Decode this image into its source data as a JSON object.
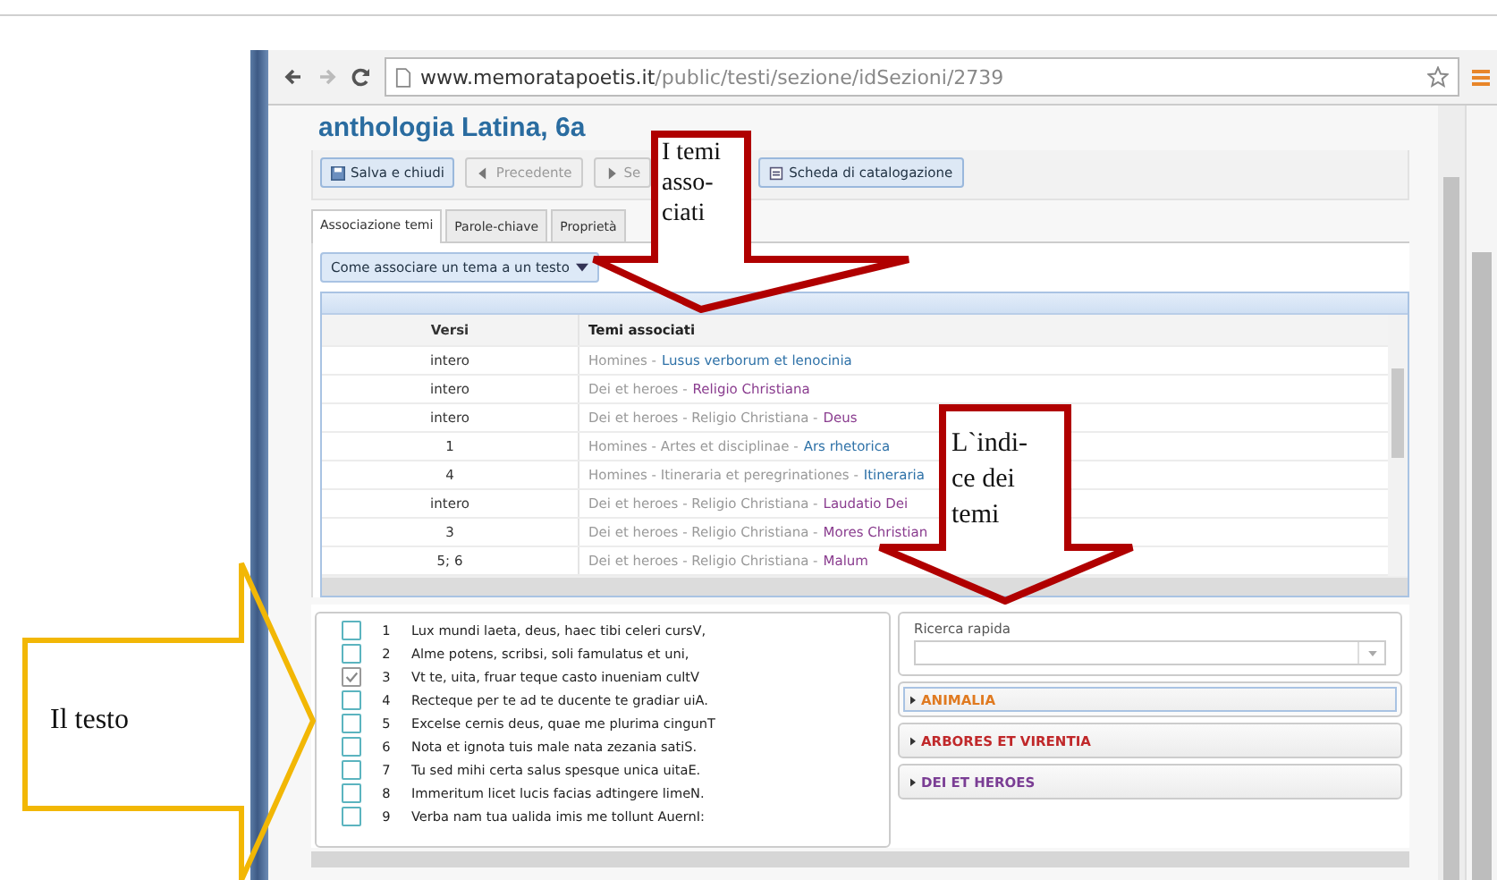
{
  "browser": {
    "url_host": "www.memoratapoetis.it",
    "url_path": "/public/testi/sezione/idSezioni/2739"
  },
  "page": {
    "title": "anthologia Latina, 6a"
  },
  "toolbar": [
    {
      "label": "Salva e chiudi",
      "kind": "save",
      "disabled": false
    },
    {
      "label": "Precedente",
      "kind": "prev",
      "disabled": true
    },
    {
      "label": "Se",
      "kind": "next",
      "disabled": true
    },
    {
      "label": "Scheda di catalogazione",
      "kind": "sheet",
      "disabled": false
    }
  ],
  "tabs": [
    {
      "label": "Associazione temi",
      "selected": true
    },
    {
      "label": "Parole-chiave",
      "selected": false
    },
    {
      "label": "Proprietà",
      "selected": false
    }
  ],
  "help_menu": {
    "label": "Come associare un tema a un testo"
  },
  "table": {
    "columns": [
      "Versi",
      "Temi associati"
    ],
    "rows": [
      {
        "verses": "intero",
        "path": "Homines -",
        "leaf": "Lusus verborum et lenocinia",
        "color": "#2f72a8"
      },
      {
        "verses": "intero",
        "path": "Dei et heroes -",
        "leaf": "Religio Christiana",
        "color": "#8a3d8f"
      },
      {
        "verses": "intero",
        "path": "Dei et heroes - Religio Christiana -",
        "leaf": "Deus",
        "color": "#8a3d8f"
      },
      {
        "verses": "1",
        "path": "Homines - Artes et disciplinae -",
        "leaf": "Ars rhetorica",
        "color": "#2f72a8"
      },
      {
        "verses": "4",
        "path": "Homines - Itineraria et peregrinationes -",
        "leaf": "Itineraria",
        "color": "#2f72a8"
      },
      {
        "verses": "intero",
        "path": "Dei et heroes - Religio Christiana -",
        "leaf": "Laudatio Dei",
        "color": "#8a3d8f"
      },
      {
        "verses": "3",
        "path": "Dei et heroes - Religio Christiana -",
        "leaf": "Mores Christian",
        "color": "#8a3d8f"
      },
      {
        "verses": "5; 6",
        "path": "Dei et heroes - Religio Christiana -",
        "leaf": "Malum",
        "color": "#8a3d8f"
      }
    ]
  },
  "verses": [
    {
      "number": "1",
      "text": "Lux mundi laeta, deus, haec tibi celeri cursV,",
      "checked": false
    },
    {
      "number": "2",
      "text": "Alme potens, scribsi, soli famulatus et uni,",
      "checked": false
    },
    {
      "number": "3",
      "text": "Vt te, uita, fruar teque casto inueniam cultV",
      "checked": true
    },
    {
      "number": "4",
      "text": "Recteque per te ad te ducente te gradiar uiA.",
      "checked": false
    },
    {
      "number": "5",
      "text": "Excelse cernis deus, quae me plurima cingunT",
      "checked": false
    },
    {
      "number": "6",
      "text": "Nota et ignota tuis male nata zezania satiS.",
      "checked": false
    },
    {
      "number": "7",
      "text": "Tu sed mihi certa salus spesque unica uitaE.",
      "checked": false
    },
    {
      "number": "8",
      "text": "Immeritum licet lucis facias adtingere limeN.",
      "checked": false
    },
    {
      "number": "9",
      "text": "Verba nam tua ualida imis me tollunt AuernI:",
      "checked": false
    }
  ],
  "quick_search": {
    "label": "Ricerca rapida"
  },
  "categories": [
    {
      "label": "ANIMALIA",
      "color": "#e07a20",
      "selected": true
    },
    {
      "label": "ARBORES ET VIRENTIA",
      "color": "#c0282a",
      "selected": false
    },
    {
      "label": "DEI ET HEROES",
      "color": "#7a3d94",
      "selected": false
    }
  ],
  "annotations": [
    {
      "text": "I temi asso-ciati",
      "color": "#b00000",
      "kind": "down"
    },
    {
      "text": "L`indi-ce dei temi",
      "color": "#b00000",
      "kind": "down"
    },
    {
      "text": "Il testo",
      "color": "#f2b705",
      "kind": "right"
    }
  ]
}
